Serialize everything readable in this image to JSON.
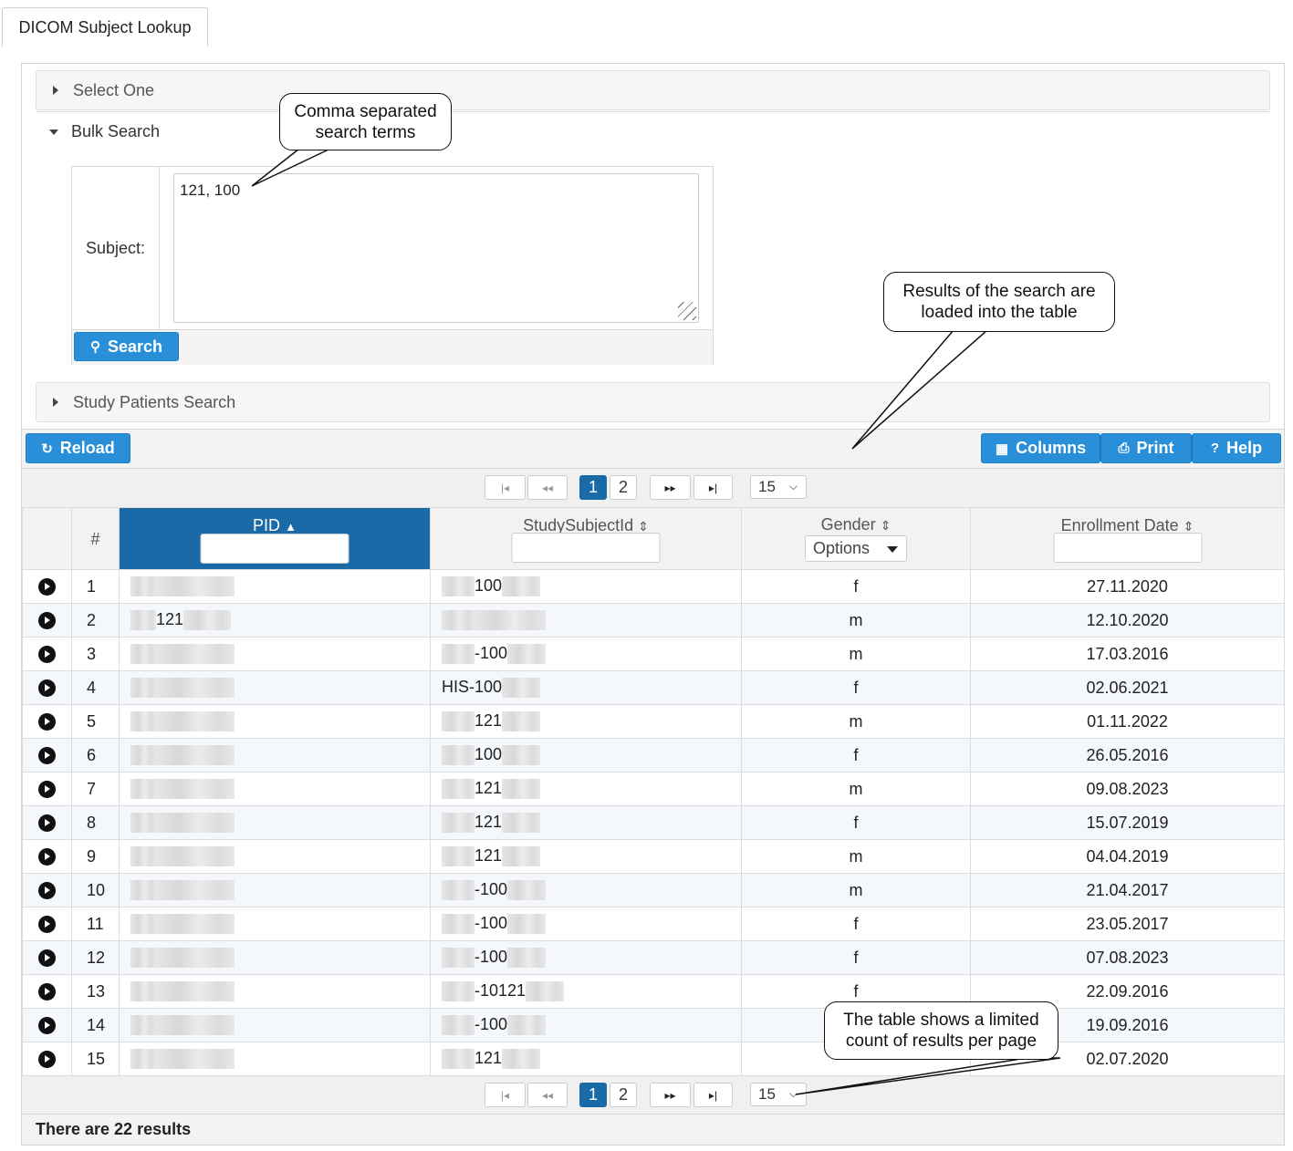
{
  "tab": {
    "label": "DICOM Subject Lookup"
  },
  "accordion": {
    "select_one": "Select One",
    "bulk_search": "Bulk Search",
    "study_patients_search": "Study Patients Search"
  },
  "bulk": {
    "subject_label": "Subject:",
    "subject_value": "121, 100",
    "search_button": "Search"
  },
  "toolbar": {
    "reload": "Reload",
    "columns": "Columns",
    "print": "Print",
    "help": "Help"
  },
  "pager": {
    "pages": [
      "1",
      "2"
    ],
    "current_page": "1",
    "page_size": "15",
    "first": "|◂",
    "prev": "◂◂",
    "next": "▸▸",
    "last": "▸|"
  },
  "table": {
    "columns": {
      "index": "#",
      "pid": "PID",
      "study_subject_id": "StudySubjectId",
      "gender": "Gender",
      "enrollment_date": "Enrollment Date"
    },
    "gender_filter": "Options",
    "rows": [
      {
        "num": "1",
        "pid": "",
        "sid_prefix": "",
        "sid": "100",
        "gender": "f",
        "date": "27.11.2020"
      },
      {
        "num": "2",
        "pid": "121",
        "sid_prefix": "",
        "sid": "",
        "gender": "m",
        "date": "12.10.2020"
      },
      {
        "num": "3",
        "pid": "",
        "sid_prefix": "",
        "sid": "-100",
        "gender": "m",
        "date": "17.03.2016"
      },
      {
        "num": "4",
        "pid": "",
        "sid_prefix": "HIS-",
        "sid": "100",
        "gender": "f",
        "date": "02.06.2021"
      },
      {
        "num": "5",
        "pid": "",
        "sid_prefix": "",
        "sid": "121",
        "gender": "m",
        "date": "01.11.2022"
      },
      {
        "num": "6",
        "pid": "",
        "sid_prefix": "",
        "sid": "100",
        "gender": "f",
        "date": "26.05.2016"
      },
      {
        "num": "7",
        "pid": "",
        "sid_prefix": "",
        "sid": "121",
        "gender": "m",
        "date": "09.08.2023"
      },
      {
        "num": "8",
        "pid": "",
        "sid_prefix": "",
        "sid": "121",
        "gender": "f",
        "date": "15.07.2019"
      },
      {
        "num": "9",
        "pid": "",
        "sid_prefix": "",
        "sid": "121",
        "gender": "m",
        "date": "04.04.2019"
      },
      {
        "num": "10",
        "pid": "",
        "sid_prefix": "",
        "sid": "-100",
        "gender": "m",
        "date": "21.04.2017"
      },
      {
        "num": "11",
        "pid": "",
        "sid_prefix": "",
        "sid": "-100",
        "gender": "f",
        "date": "23.05.2017"
      },
      {
        "num": "12",
        "pid": "",
        "sid_prefix": "",
        "sid": "-100",
        "gender": "f",
        "date": "07.08.2023"
      },
      {
        "num": "13",
        "pid": "",
        "sid_prefix": "",
        "sid": "-10121",
        "gender": "f",
        "date": "22.09.2016"
      },
      {
        "num": "14",
        "pid": "",
        "sid_prefix": "",
        "sid": "-100",
        "gender": "",
        "date": "19.09.2016"
      },
      {
        "num": "15",
        "pid": "",
        "sid_prefix": "",
        "sid": "121",
        "gender": "",
        "date": "02.07.2020"
      }
    ]
  },
  "footer": {
    "results": "There are 22 results"
  },
  "callouts": {
    "search_terms": "Comma separated search terms",
    "results_loaded": "Results of the search are loaded into the table",
    "limited_count": "The table shows a limited count of results per page"
  },
  "colors": {
    "primary_button": "#2a8fd9",
    "sorted_header": "#1a6aa8",
    "active_page": "#1a6aa8"
  }
}
